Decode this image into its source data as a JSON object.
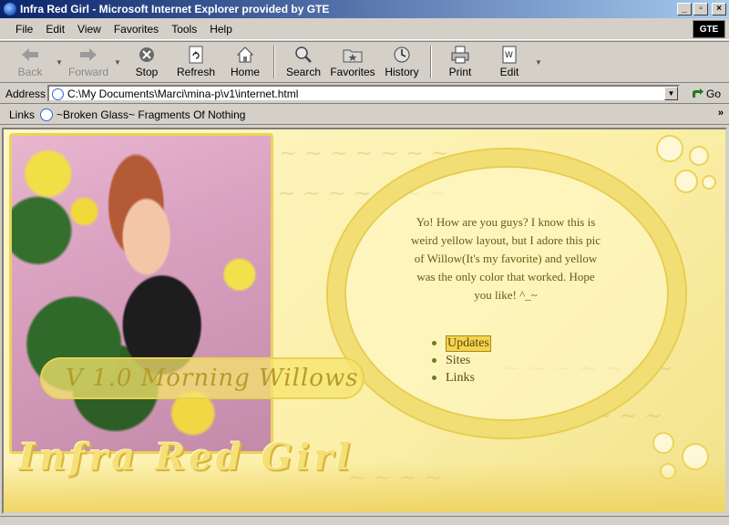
{
  "window": {
    "title": "Infra Red Girl - Microsoft Internet Explorer provided by GTE",
    "minimize": "_",
    "maximize": "▫",
    "close": "×"
  },
  "menu": [
    "File",
    "Edit",
    "View",
    "Favorites",
    "Tools",
    "Help"
  ],
  "brand": "GTE",
  "toolbar": {
    "back": "Back",
    "forward": "Forward",
    "stop": "Stop",
    "refresh": "Refresh",
    "home": "Home",
    "search": "Search",
    "favorites": "Favorites",
    "history": "History",
    "print": "Print",
    "edit": "Edit"
  },
  "address": {
    "label": "Address",
    "value": "C:\\My Documents\\Marci\\mina-p\\v1\\internet.html",
    "go": "Go"
  },
  "links": {
    "label": "Links",
    "item": "~Broken Glass~ Fragments Of Nothing",
    "more": "»"
  },
  "page": {
    "version_banner": "V 1.0 Morning Willows",
    "intro": "Yo! How are you guys? I know this is weird yellow layout, but I adore this pic of Willow(It's my favorite) and yellow was the only color that worked. Hope you like! ^_~",
    "nav": [
      "Updates",
      "Sites",
      "Links"
    ],
    "logo": "Infra Red Girl"
  },
  "colors": {
    "titlebar_start": "#0a246a",
    "titlebar_end": "#a6caf0",
    "page_bg": "#fbf2b8",
    "accent": "#f1de75"
  }
}
